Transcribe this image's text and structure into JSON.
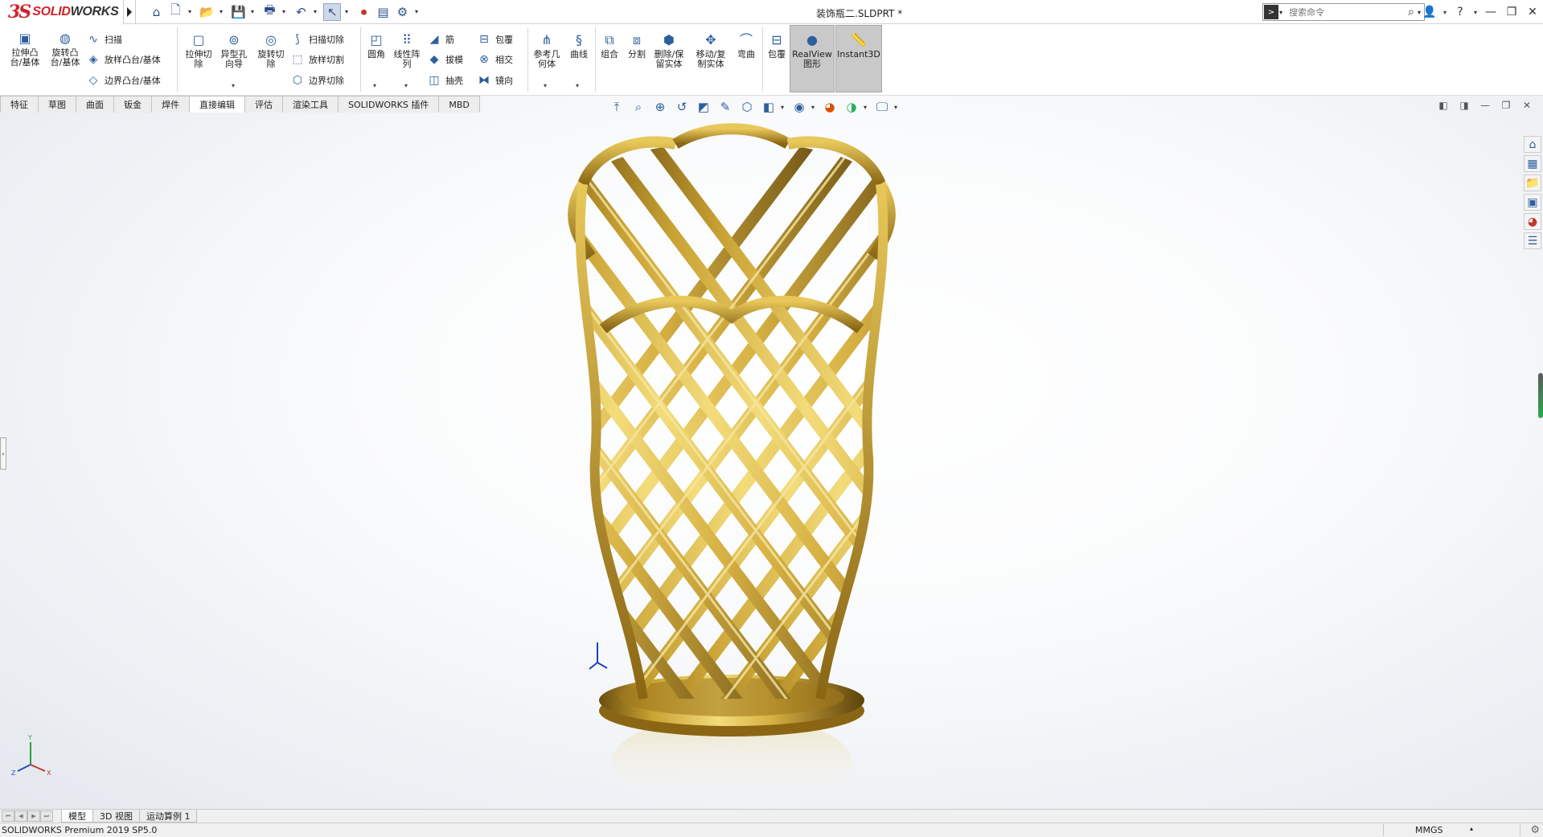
{
  "app": {
    "brand": "SOLIDWORKS",
    "brand_prefix": "SOLID",
    "brand_suffix": "WORKS",
    "logo_mark": "3S",
    "doc_title": "装饰瓶二.SLDPRT *"
  },
  "search": {
    "placeholder": "搜索命令",
    "cmd_glyph": ">"
  },
  "window": {
    "help": "?",
    "dd": "▾"
  },
  "commands": {
    "extrude_boss": "拉伸凸\n台/基体",
    "revolve_boss": "旋转凸\n台/基体",
    "sweep": "扫描",
    "loft": "放样凸台/基体",
    "boundary": "边界凸台/基体",
    "extrude_cut": "拉伸切\n除",
    "hole_wizard": "异型孔\n向导",
    "revolve_cut": "旋转切\n除",
    "sweep_cut": "扫描切除",
    "loft_cut": "放样切割",
    "boundary_cut": "边界切除",
    "fillet": "圆角",
    "linear_pattern": "线性阵\n列",
    "rib": "筋",
    "draft": "拔模",
    "shell": "抽壳",
    "wrap": "包覆",
    "intersect": "相交",
    "mirror": "镜向",
    "ref_geometry": "参考几\n何体",
    "curves": "曲线",
    "combine": "组合",
    "split": "分割",
    "delete_keep": "删除/保\n留实体",
    "move_copy": "移动/复\n制实体",
    "flex": "弯曲",
    "wrap2": "包覆",
    "realview": "RealView\n图形",
    "instant3d": "Instant3D"
  },
  "tabs": [
    "特征",
    "草图",
    "曲面",
    "钣金",
    "焊件",
    "直接编辑",
    "评估",
    "渲染工具",
    "SOLIDWORKS 插件",
    "MBD"
  ],
  "active_tab": "直接编辑",
  "bottom_tabs": [
    "模型",
    "3D 视图",
    "运动算例 1"
  ],
  "active_bottom_tab": "模型",
  "status": {
    "product": "SOLIDWORKS Premium 2019 SP5.0",
    "units": "MMGS",
    "units_dd": "▴"
  },
  "triad": {
    "x": "X",
    "y": "Y",
    "z": "Z"
  },
  "colors": {
    "brand_red": "#d2232a",
    "gold_light": "#f3dc7a",
    "gold_mid": "#c9a233",
    "gold_dark": "#6b4e10",
    "icon_blue": "#2d5f9e"
  }
}
